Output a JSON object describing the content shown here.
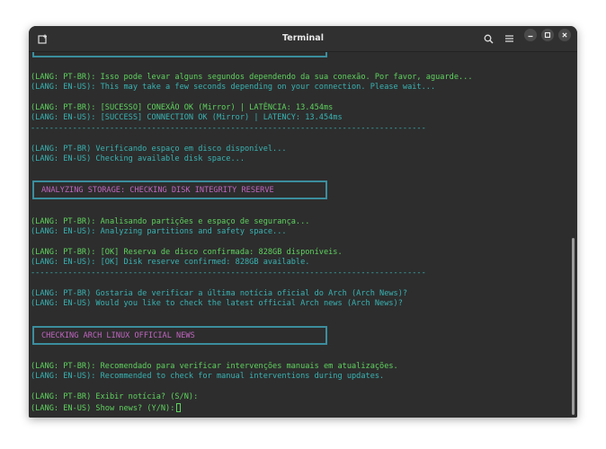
{
  "window": {
    "title": "Terminal",
    "icons": {
      "new_tab": "new-tab-icon",
      "search": "search-icon",
      "menu": "hamburger-menu-icon",
      "minimize": "minimize-icon",
      "maximize": "maximize-icon",
      "close": "close-icon"
    }
  },
  "colors": {
    "green": "#5fd35f",
    "cyan": "#39b3b3",
    "magenta": "#c066c0",
    "box_border": "#3b8e9e",
    "background": "#2d2d2d"
  },
  "terminal": {
    "lines": [
      "(LANG: PT-BR): Isso pode levar alguns segundos dependendo da sua conexão. Por favor, aguarde...",
      "(LANG: EN-US): This may take a few seconds depending on your connection. Please wait...",
      "(LANG: PT-BR): [SUCESSO] CONEXÃO OK (Mirror) | LATÊNCIA: 13.454ms",
      "(LANG: EN-US): [SUCCESS] CONNECTION OK (Mirror) | LATENCY: 13.454ms",
      "-------------------------------------------------------------------------------------",
      "(LANG: PT-BR) Verificando espaço em disco disponível...",
      "(LANG: EN-US) Checking available disk space...",
      "(LANG: PT-BR): Analisando partições e espaço de segurança...",
      "(LANG: EN-US): Analyzing partitions and safety space...",
      "(LANG: PT-BR): [OK] Reserva de disco confirmada: 828GB disponíveis.",
      "(LANG: EN-US): [OK] Disk reserve confirmed: 828GB available.",
      "-------------------------------------------------------------------------------------",
      "(LANG: PT-BR) Gostaria de verificar a última notícia oficial do Arch (Arch News)?",
      "(LANG: EN-US) Would you like to check the latest official Arch news (Arch News)?",
      "(LANG: PT-BR): Recomendado para verificar intervenções manuais em atualizações.",
      "(LANG: EN-US): Recommended to check for manual interventions during updates.",
      "(LANG: PT-BR) Exibir notícia? (S/N):",
      "(LANG: EN-US) Show news? (Y/N):"
    ],
    "boxes": [
      "ANALYZING STORAGE: CHECKING DISK INTEGRITY RESERVE",
      "CHECKING ARCH LINUX OFFICIAL NEWS"
    ]
  }
}
